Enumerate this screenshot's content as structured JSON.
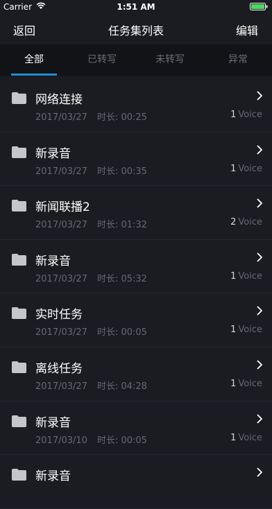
{
  "status": {
    "carrier": "Carrier",
    "time": "1:51 AM"
  },
  "nav": {
    "back_label": "返回",
    "title": "任务集列表",
    "edit_label": "编辑"
  },
  "tabs": [
    {
      "label": "全部",
      "active": true
    },
    {
      "label": "已转写",
      "active": false
    },
    {
      "label": "未转写",
      "active": false
    },
    {
      "label": "异常",
      "active": false
    }
  ],
  "colors": {
    "accent": "#1e8fd8",
    "background": "#1b1c22",
    "tabbar": "#121317"
  },
  "tasks": [
    {
      "name": "网络连接",
      "date": "2017/03/27",
      "duration": "时长: 00:25",
      "count": "1",
      "unit": "Voice"
    },
    {
      "name": "新录音",
      "date": "2017/03/27",
      "duration": "时长: 00:35",
      "count": "1",
      "unit": "Voice"
    },
    {
      "name": "新闻联播2",
      "date": "2017/03/27",
      "duration": "时长: 01:32",
      "count": "2",
      "unit": "Voice"
    },
    {
      "name": "新录音",
      "date": "2017/03/27",
      "duration": "时长: 05:32",
      "count": "1",
      "unit": "Voice"
    },
    {
      "name": "实时任务",
      "date": "2017/03/27",
      "duration": "时长: 00:05",
      "count": "1",
      "unit": "Voice"
    },
    {
      "name": "离线任务",
      "date": "2017/03/27",
      "duration": "时长: 04:28",
      "count": "1",
      "unit": "Voice"
    },
    {
      "name": "新录音",
      "date": "2017/03/10",
      "duration": "时长: 00:05",
      "count": "1",
      "unit": "Voice"
    },
    {
      "name": "新录音",
      "date": "",
      "duration": "",
      "count": "",
      "unit": ""
    }
  ]
}
